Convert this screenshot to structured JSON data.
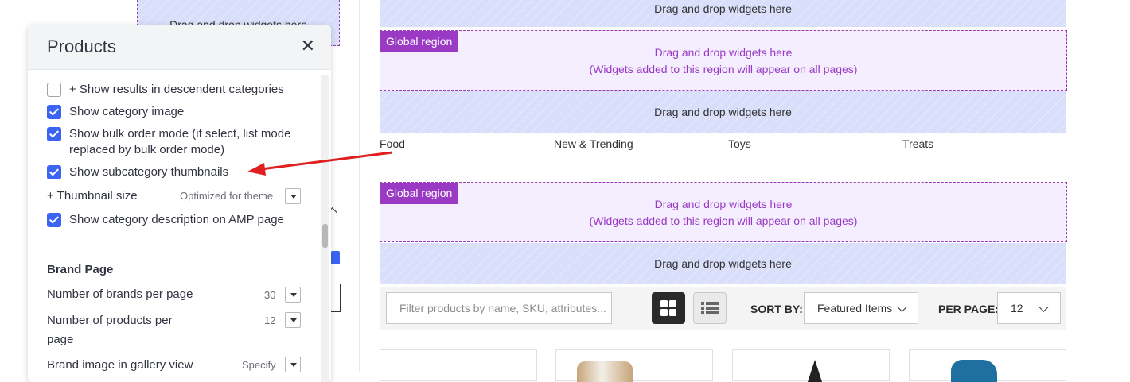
{
  "panel": {
    "title": "Products",
    "options": [
      {
        "label": "+ Show results in descendent categories",
        "checked": false
      },
      {
        "label": "Show category image",
        "checked": true
      },
      {
        "label": "Show bulk order mode (if select, list mode",
        "label2": "replaced by bulk order mode)",
        "checked": true
      },
      {
        "label": "Show subcategory thumbnails",
        "checked": true
      },
      {
        "label": "Show category description on AMP page",
        "checked": true
      }
    ],
    "thumbnail_size": {
      "label": "+ Thumbnail size",
      "value": "Optimized for theme"
    },
    "brand_section": "Brand Page",
    "brand_settings": [
      {
        "label": "Number of brands per page",
        "value": "30"
      },
      {
        "label": "Number of products per",
        "label2": "page",
        "value": "12"
      },
      {
        "label": "Brand image in gallery view",
        "value": "Specify"
      }
    ]
  },
  "canvas": {
    "drop_text": "Drag and drop widgets here",
    "global_label": "Global region",
    "global_text_1": "Drag and drop widgets here",
    "global_text_2": "(Widgets added to this region will appear on all pages)",
    "categories": [
      "Food",
      "New & Trending",
      "Toys",
      "Treats"
    ]
  },
  "toolbar": {
    "filter_placeholder": "Filter products by name, SKU, attributes...",
    "sort_label": "SORT BY:",
    "sort_value": "Featured Items",
    "per_page_label": "PER PAGE:",
    "per_page_value": "12"
  },
  "colors": {
    "accent": "#3c64f4",
    "global_region": "#9a39c4",
    "annotation_arrow": "#e02020"
  }
}
